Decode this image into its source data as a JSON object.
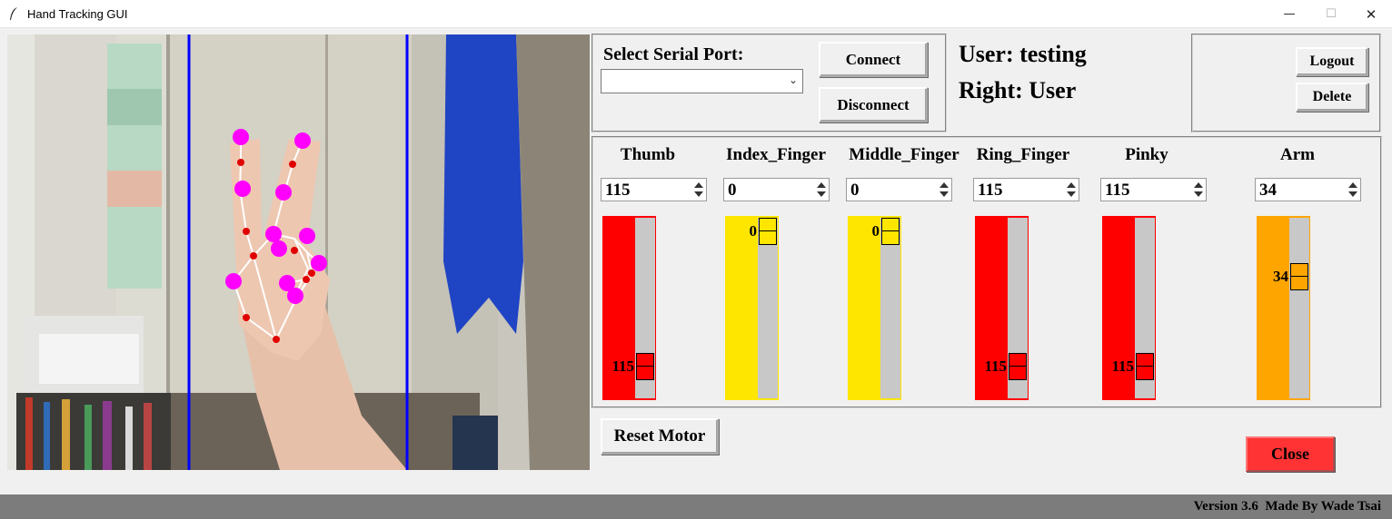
{
  "window": {
    "title": "Hand Tracking GUI",
    "controls": {
      "minimize": "—",
      "maximize": "☐",
      "close": "✕"
    }
  },
  "serial": {
    "label": "Select Serial Port:",
    "port_value": "",
    "connect_label": "Connect",
    "disconnect_label": "Disconnect"
  },
  "user": {
    "user_line": "User: testing",
    "right_line": "Right: User",
    "logout_label": "Logout",
    "delete_label": "Delete"
  },
  "motors": [
    {
      "name": "Thumb",
      "value": "115",
      "fraction": 1.0,
      "color": "#ff0000"
    },
    {
      "name": "Index_Finger",
      "value": "0",
      "fraction": 0.0,
      "color": "#ffe600"
    },
    {
      "name": "Middle_Finger",
      "value": "0",
      "fraction": 0.0,
      "color": "#ffe600"
    },
    {
      "name": "Ring_Finger",
      "value": "115",
      "fraction": 1.0,
      "color": "#ff0000"
    },
    {
      "name": "Pinky",
      "value": "115",
      "fraction": 1.0,
      "color": "#ff0000"
    },
    {
      "name": "Arm",
      "value": "34",
      "fraction": 0.3,
      "color": "#ffa500"
    }
  ],
  "actions": {
    "reset_label": "Reset Motor",
    "close_label": "Close",
    "close_color": "#ff3333"
  },
  "status": {
    "version_text": "Version 3.6  Made By Wade Tsai"
  },
  "camera": {
    "guide_line_color": "#0000ff",
    "landmark_color": "#ff00ff",
    "joint_color": "#e00000"
  }
}
